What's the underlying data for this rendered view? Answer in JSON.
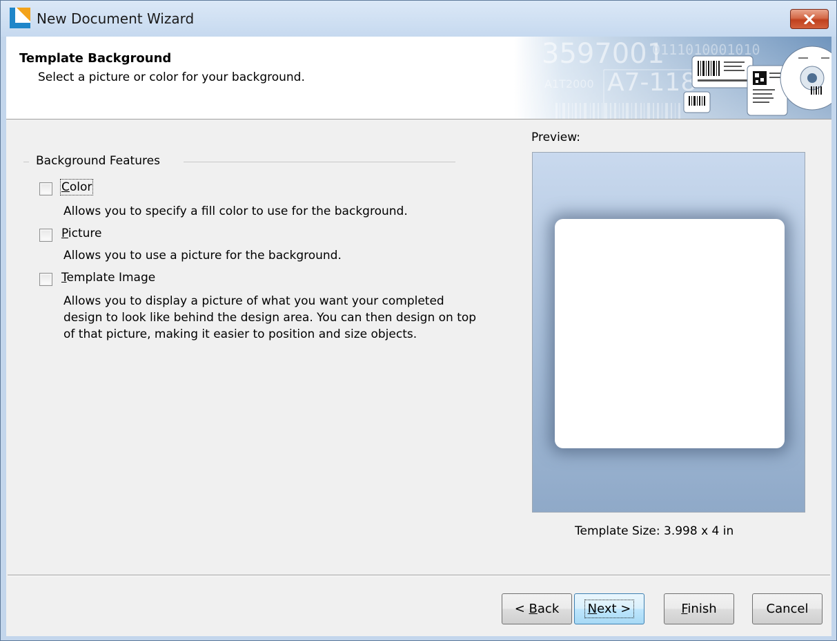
{
  "window": {
    "title": "New Document Wizard",
    "close_icon": "close-icon",
    "close_glyph": "✕"
  },
  "header": {
    "title": "Template Background",
    "subtitle": "Select a picture or color for your background.",
    "banner": {
      "number_top": "3597001",
      "binary_text": "0111010001010",
      "code_1": "A7-118",
      "code_2": "A1T2000"
    }
  },
  "features": {
    "group_label": "Background Features",
    "items": [
      {
        "label_pre": "",
        "label_key": "C",
        "label_post": "olor",
        "checked": false,
        "description": "Allows you to specify a fill color to use for the background."
      },
      {
        "label_pre": "",
        "label_key": "P",
        "label_post": "icture",
        "checked": false,
        "description": "Allows you to use a picture for the background."
      },
      {
        "label_pre": "",
        "label_key": "T",
        "label_post": "emplate Image",
        "checked": false,
        "description": "Allows you to display a picture of what you want your completed design to look like behind the design area. You can then design on top of that picture, making it easier to position and size objects."
      }
    ]
  },
  "preview": {
    "label": "Preview:",
    "template_size": "Template Size:  3.998 x 4 in"
  },
  "buttons": {
    "back": {
      "pre": "< ",
      "key": "B",
      "post": "ack"
    },
    "next": {
      "pre": "",
      "key": "N",
      "post": "ext >"
    },
    "finish": {
      "pre": "",
      "key": "F",
      "post": "inish"
    },
    "cancel": {
      "label": "Cancel"
    }
  },
  "colors": {
    "titlebar": "#c6d9ef",
    "client_bg": "#f0f0f0",
    "default_button": "#bee6fd",
    "close_button": "#c0401e"
  }
}
